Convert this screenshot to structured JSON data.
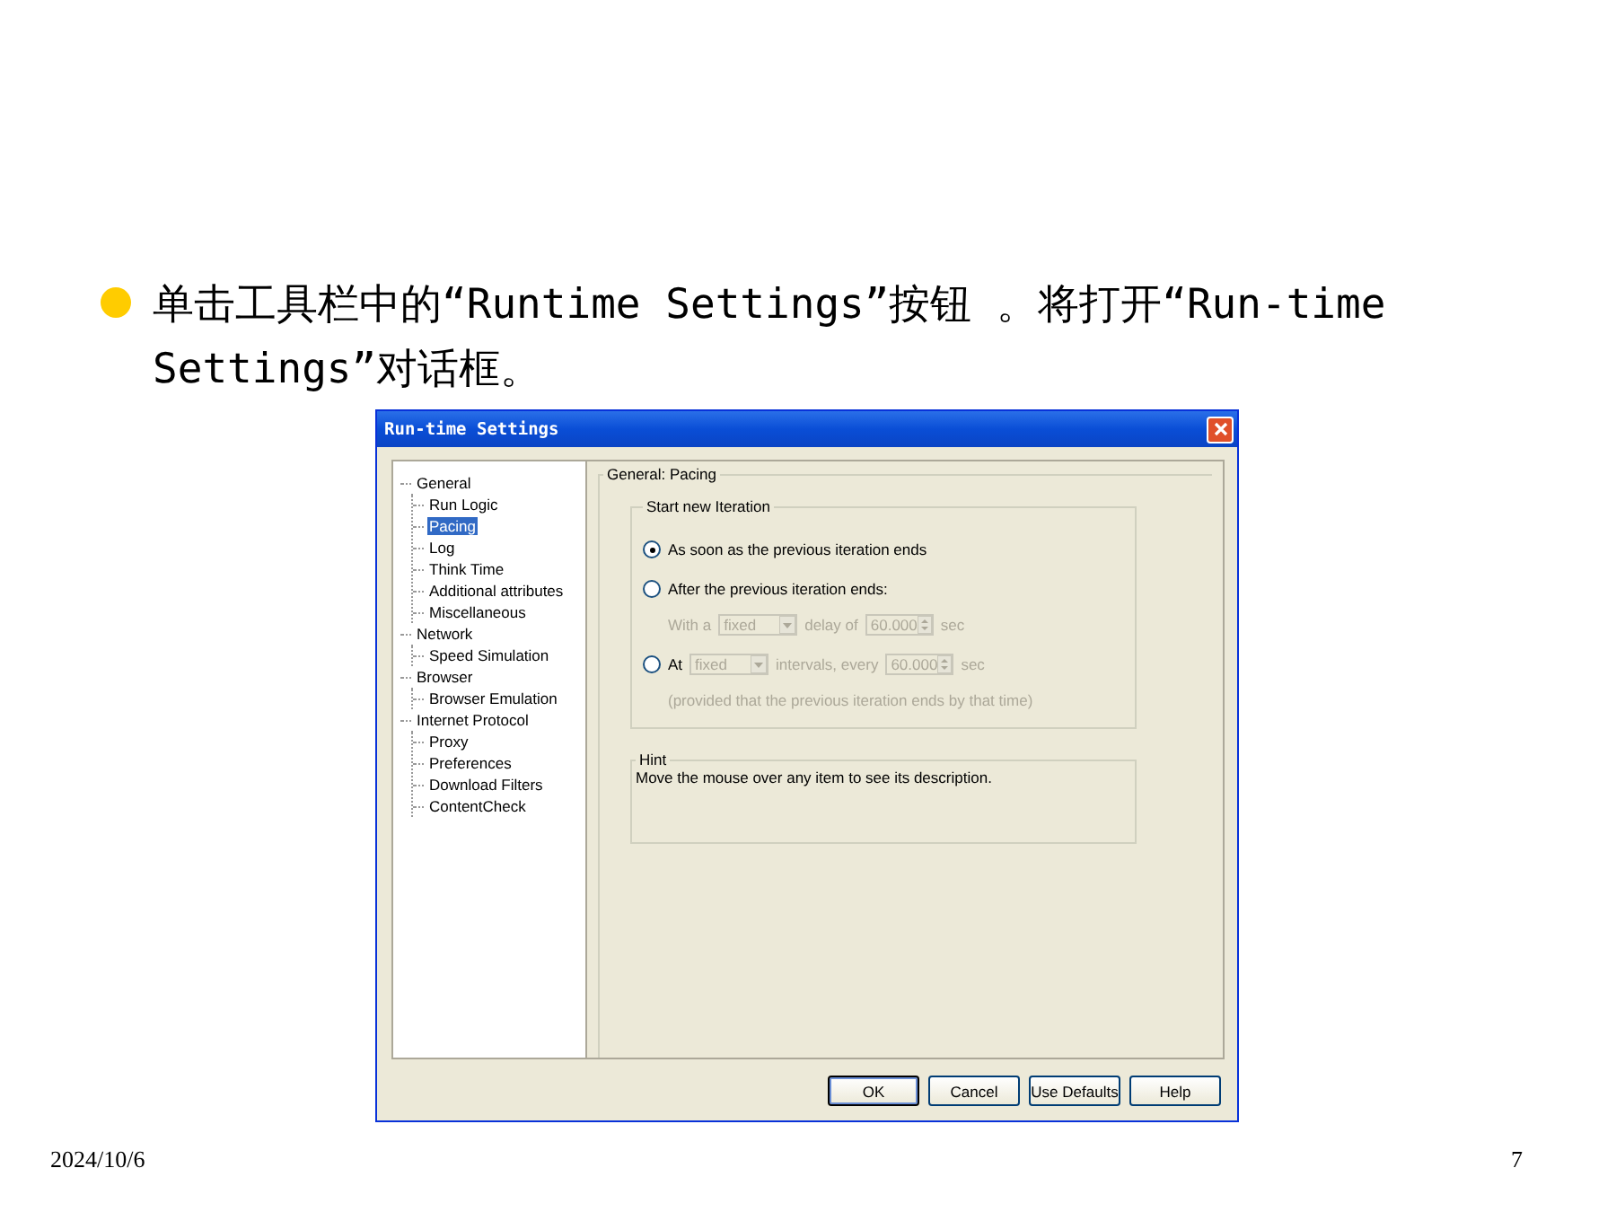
{
  "slide": {
    "bullet_text": "单击工具栏中的“Runtime Settings”按钮 。将打开“Run-time Settings”对话框。",
    "date": "2024/10/6",
    "page_number": "7"
  },
  "window": {
    "title": "Run-time Settings"
  },
  "tree": [
    {
      "label": "General",
      "selected": false,
      "children": [
        {
          "label": "Run Logic",
          "selected": false
        },
        {
          "label": "Pacing",
          "selected": true
        },
        {
          "label": "Log",
          "selected": false
        },
        {
          "label": "Think Time",
          "selected": false
        },
        {
          "label": "Additional attributes",
          "selected": false
        },
        {
          "label": "Miscellaneous",
          "selected": false
        }
      ]
    },
    {
      "label": "Network",
      "selected": false,
      "children": [
        {
          "label": "Speed Simulation",
          "selected": false
        }
      ]
    },
    {
      "label": "Browser",
      "selected": false,
      "children": [
        {
          "label": "Browser Emulation",
          "selected": false
        }
      ]
    },
    {
      "label": "Internet Protocol",
      "selected": false,
      "children": [
        {
          "label": "Proxy",
          "selected": false
        },
        {
          "label": "Preferences",
          "selected": false
        },
        {
          "label": "Download Filters",
          "selected": false
        },
        {
          "label": "ContentCheck",
          "selected": false
        }
      ]
    }
  ],
  "panel": {
    "title": "General: Pacing",
    "group_title": "Start new Iteration",
    "options": [
      {
        "selected": true,
        "parts": [
          {
            "kind": "text",
            "text": "As soon as the previous iteration ends",
            "disabled": false
          }
        ]
      },
      {
        "selected": false,
        "parts": [
          {
            "kind": "text",
            "text": "After the previous iteration ends:",
            "disabled": false
          }
        ],
        "rows": [
          [
            {
              "kind": "text",
              "text": "With a",
              "disabled": true
            },
            {
              "kind": "select",
              "text": "fixed",
              "disabled": true
            },
            {
              "kind": "text",
              "text": "delay of",
              "disabled": true
            },
            {
              "kind": "spin",
              "text": "60.000",
              "disabled": true
            },
            {
              "kind": "text",
              "text": "sec",
              "disabled": true
            }
          ]
        ]
      },
      {
        "selected": false,
        "parts": [
          {
            "kind": "text",
            "text": "At",
            "disabled": false
          },
          {
            "kind": "select",
            "text": "fixed",
            "disabled": true
          },
          {
            "kind": "text",
            "text": "intervals, every",
            "disabled": true
          },
          {
            "kind": "spin",
            "text": "60.000",
            "disabled": true
          },
          {
            "kind": "text",
            "text": "sec",
            "disabled": true
          }
        ],
        "rows": [
          [
            {
              "kind": "text",
              "text": "(provided that the previous iteration ends by that time)",
              "disabled": true
            }
          ]
        ]
      }
    ],
    "hint_title": "Hint",
    "hint_text": "Move the mouse over any item to see its description."
  },
  "buttons": [
    {
      "label": "OK",
      "default": true
    },
    {
      "label": "Cancel",
      "default": false
    },
    {
      "label": "Use Defaults",
      "default": false
    },
    {
      "label": "Help",
      "default": false
    }
  ]
}
